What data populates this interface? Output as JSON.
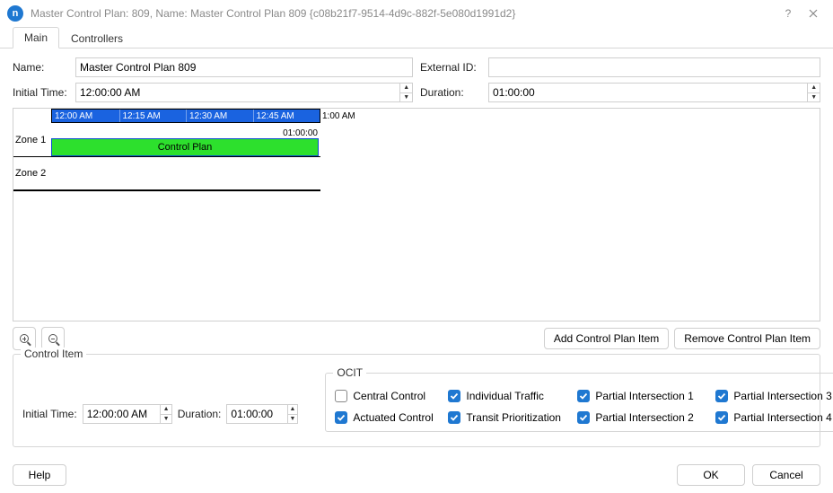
{
  "window": {
    "title": "Master Control Plan: 809, Name: Master Control Plan 809  {c08b21f7-9514-4d9c-882f-5e080d1991d2}",
    "appicon_letter": "n"
  },
  "tabs": {
    "main": "Main",
    "controllers": "Controllers"
  },
  "fields": {
    "name_label": "Name:",
    "name_value": "Master Control Plan 809",
    "external_id_label": "External ID:",
    "external_id_value": "",
    "initial_time_label": "Initial Time:",
    "initial_time_value": "12:00:00 AM",
    "duration_label": "Duration:",
    "duration_value": "01:00:00"
  },
  "timeline": {
    "ticks": [
      "12:00 AM",
      "12:15 AM",
      "12:30 AM",
      "12:45 AM"
    ],
    "end_label": "1:00 AM",
    "zone1_label": "Zone 1",
    "zone2_label": "Zone 2",
    "block_label": "Control Plan",
    "block_time": "01:00:00"
  },
  "buttons": {
    "add_item": "Add Control Plan Item",
    "remove_item": "Remove Control Plan Item",
    "help": "Help",
    "ok": "OK",
    "cancel": "Cancel"
  },
  "control_item": {
    "legend": "Control Item",
    "initial_time_label": "Initial Time:",
    "initial_time_value": "12:00:00 AM",
    "duration_label": "Duration:",
    "duration_value": "01:00:00"
  },
  "ocit": {
    "legend": "OCIT",
    "items": [
      {
        "label": "Central Control",
        "checked": false
      },
      {
        "label": "Individual Traffic",
        "checked": true
      },
      {
        "label": "Partial Intersection 1",
        "checked": true
      },
      {
        "label": "Partial Intersection 3",
        "checked": true
      },
      {
        "label": "Actuated Control",
        "checked": true
      },
      {
        "label": "Transit Prioritization",
        "checked": true
      },
      {
        "label": "Partial Intersection 2",
        "checked": true
      },
      {
        "label": "Partial Intersection 4",
        "checked": true
      }
    ]
  }
}
